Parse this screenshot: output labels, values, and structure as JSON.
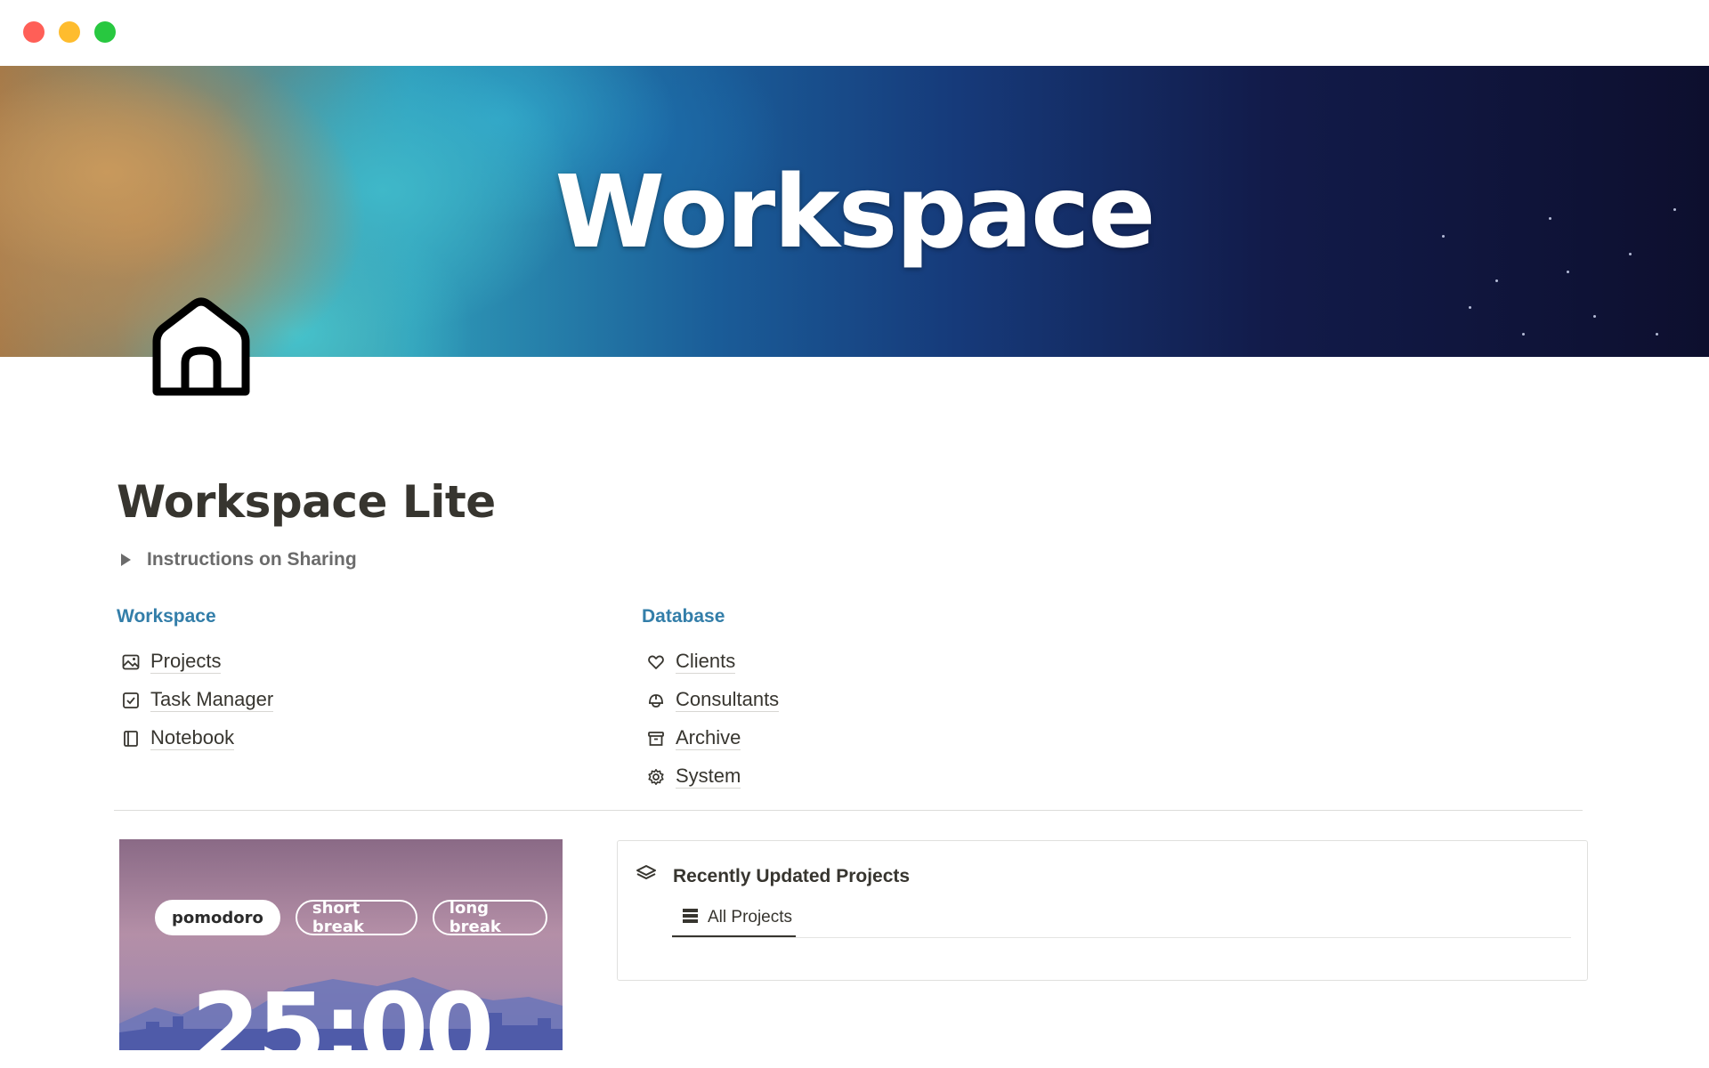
{
  "window": {
    "controls": [
      "close",
      "minimize",
      "zoom"
    ]
  },
  "cover": {
    "title": "Workspace"
  },
  "page": {
    "icon": "house-icon",
    "title": "Workspace Lite",
    "toggle_label": "Instructions on Sharing"
  },
  "workspace_links": {
    "heading": "Workspace",
    "items": [
      {
        "label": "Projects",
        "icon": "image-icon"
      },
      {
        "label": "Task Manager",
        "icon": "checkbox-icon"
      },
      {
        "label": "Notebook",
        "icon": "book-icon"
      }
    ]
  },
  "database_links": {
    "heading": "Database",
    "items": [
      {
        "label": "Clients",
        "icon": "heart-icon"
      },
      {
        "label": "Consultants",
        "icon": "helmet-icon"
      },
      {
        "label": "Archive",
        "icon": "archive-icon"
      },
      {
        "label": "System",
        "icon": "gear-icon"
      }
    ]
  },
  "pomodoro": {
    "modes": [
      "pomodoro",
      "short break",
      "long break"
    ],
    "active_mode": "pomodoro",
    "time": "25:00"
  },
  "recent_projects": {
    "title": "Recently Updated Projects",
    "icon": "layers-icon",
    "tab_label": "All Projects",
    "tab_icon": "table-icon"
  },
  "colors": {
    "link_heading": "#337ea9",
    "text": "#37352f",
    "muted": "#6b6b6b"
  }
}
